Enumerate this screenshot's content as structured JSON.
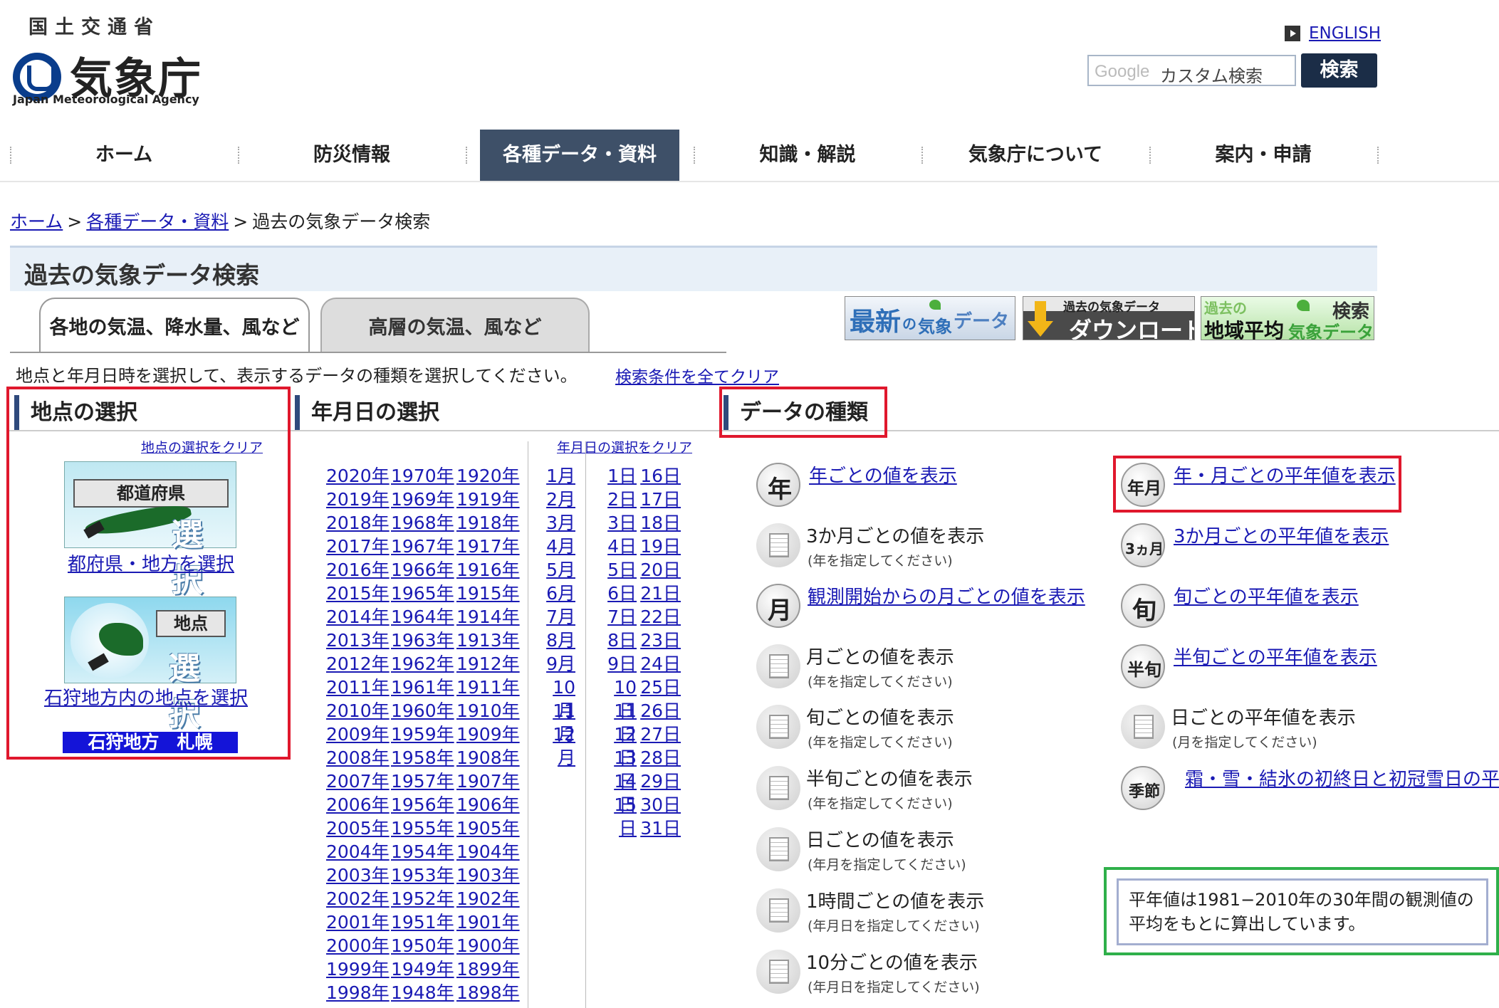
{
  "header": {
    "ministry": "国土交通省",
    "agency_ja": "気象庁",
    "agency_en": "Japan Meteorological Agency",
    "english_link": "ENGLISH",
    "search_brand": "Google",
    "search_placeholder": "カスタム検索",
    "search_button": "検索"
  },
  "nav": [
    "ホーム",
    "防災情報",
    "各種データ・資料",
    "知識・解説",
    "気象庁について",
    "案内・申請"
  ],
  "breadcrumb": {
    "home": "ホーム",
    "data": "各種データ・資料",
    "current": "過去の気象データ検索"
  },
  "page_title": "過去の気象データ検索",
  "tabs": [
    "各地の気温、降水量、風など",
    "高層の気温、風など"
  ],
  "banners": {
    "latest": {
      "a": "最新",
      "b": "の",
      "c": "気象",
      "d": "データ"
    },
    "download": {
      "a": "過去の気象データ",
      "b": "ダウンロード"
    },
    "normal": {
      "a": "過去の",
      "b": "地域平均",
      "c": "気象データ",
      "d": "検索"
    }
  },
  "instruction": "地点と年月日時を選択して、表示するデータの種類を選択してください。",
  "clear_all": "検索条件を全てクリア",
  "station": {
    "heading": "地点の選択",
    "clear": "地点の選択をクリア",
    "img1_label": "都道府県",
    "img1_big": "選択",
    "link1": "都府県・地方を選択",
    "img2_label": "地点",
    "img2_big": "選択",
    "link2": "石狩地方内の地点を選択",
    "selected": "石狩地方　札幌"
  },
  "date": {
    "heading": "年月日の選択",
    "clear": "年月日の選択をクリア",
    "years_col1": [
      "2020年",
      "2019年",
      "2018年",
      "2017年",
      "2016年",
      "2015年",
      "2014年",
      "2013年",
      "2012年",
      "2011年",
      "2010年",
      "2009年",
      "2008年",
      "2007年",
      "2006年",
      "2005年",
      "2004年",
      "2003年",
      "2002年",
      "2001年",
      "2000年",
      "1999年",
      "1998年"
    ],
    "years_col2": [
      "1970年",
      "1969年",
      "1968年",
      "1967年",
      "1966年",
      "1965年",
      "1964年",
      "1963年",
      "1962年",
      "1961年",
      "1960年",
      "1959年",
      "1958年",
      "1957年",
      "1956年",
      "1955年",
      "1954年",
      "1953年",
      "1952年",
      "1951年",
      "1950年",
      "1949年",
      "1948年"
    ],
    "years_col3": [
      "1920年",
      "1919年",
      "1918年",
      "1917年",
      "1916年",
      "1915年",
      "1914年",
      "1913年",
      "1912年",
      "1911年",
      "1910年",
      "1909年",
      "1908年",
      "1907年",
      "1906年",
      "1905年",
      "1904年",
      "1903年",
      "1902年",
      "1901年",
      "1900年",
      "1899年",
      "1898年"
    ],
    "months": [
      "1月",
      "2月",
      "3月",
      "4月",
      "5月",
      "6月",
      "7月",
      "8月",
      "9月",
      "10月",
      "11月",
      "12月"
    ],
    "days_col1": [
      "1日",
      "2日",
      "3日",
      "4日",
      "5日",
      "6日",
      "7日",
      "8日",
      "9日",
      "10日",
      "11日",
      "12日",
      "13日",
      "14日",
      "15日"
    ],
    "days_col2": [
      "16日",
      "17日",
      "18日",
      "19日",
      "20日",
      "21日",
      "22日",
      "23日",
      "24日",
      "25日",
      "26日",
      "27日",
      "28日",
      "29日",
      "30日",
      "31日"
    ]
  },
  "datatype": {
    "heading": "データの種類",
    "left": [
      {
        "title": "年ごとの値を表示",
        "sub": "",
        "icon": "年",
        "link": true
      },
      {
        "title": "3か月ごとの値を表示",
        "sub": "(年を指定してください)",
        "icon": "grid",
        "link": false
      },
      {
        "title": "観測開始からの月ごとの値を表示",
        "sub": "",
        "icon": "月",
        "link": true
      },
      {
        "title": "月ごとの値を表示",
        "sub": "(年を指定してください)",
        "icon": "grid",
        "link": false
      },
      {
        "title": "旬ごとの値を表示",
        "sub": "(年を指定してください)",
        "icon": "grid",
        "link": false
      },
      {
        "title": "半旬ごとの値を表示",
        "sub": "(年を指定してください)",
        "icon": "grid",
        "link": false
      },
      {
        "title": "日ごとの値を表示",
        "sub": "(年月を指定してください)",
        "icon": "grid",
        "link": false
      },
      {
        "title": "1時間ごとの値を表示",
        "sub": "(年月日を指定してください)",
        "icon": "grid",
        "link": false
      },
      {
        "title": "10分ごとの値を表示",
        "sub": "(年月日を指定してください)",
        "icon": "grid",
        "link": false
      }
    ],
    "right": [
      {
        "title": "年・月ごとの平年値を表示",
        "sub": "",
        "icon": "年月",
        "link": true
      },
      {
        "title": "3か月ごとの平年値を表示",
        "sub": "",
        "icon": "3ヵ月",
        "link": true
      },
      {
        "title": "旬ごとの平年値を表示",
        "sub": "",
        "icon": "旬",
        "link": true
      },
      {
        "title": "半旬ごとの平年値を表示",
        "sub": "",
        "icon": "半旬",
        "link": true
      },
      {
        "title": "日ごとの平年値を表示",
        "sub": "(月を指定してください)",
        "icon": "grid",
        "link": false
      },
      {
        "title": "霜・雪・結氷の初終日と初冠雪日の平",
        "sub": "",
        "icon": "季節",
        "link": true
      }
    ],
    "note": "平年値は1981−2010年の30年間の観測値の平均をもとに算出しています。"
  },
  "colors": {
    "nav_active": "#3e5068",
    "link": "#1a1ab4",
    "highlight_red": "#e0182d",
    "highlight_green": "#2fb04a",
    "selected_station_bg": "#1414d8"
  }
}
